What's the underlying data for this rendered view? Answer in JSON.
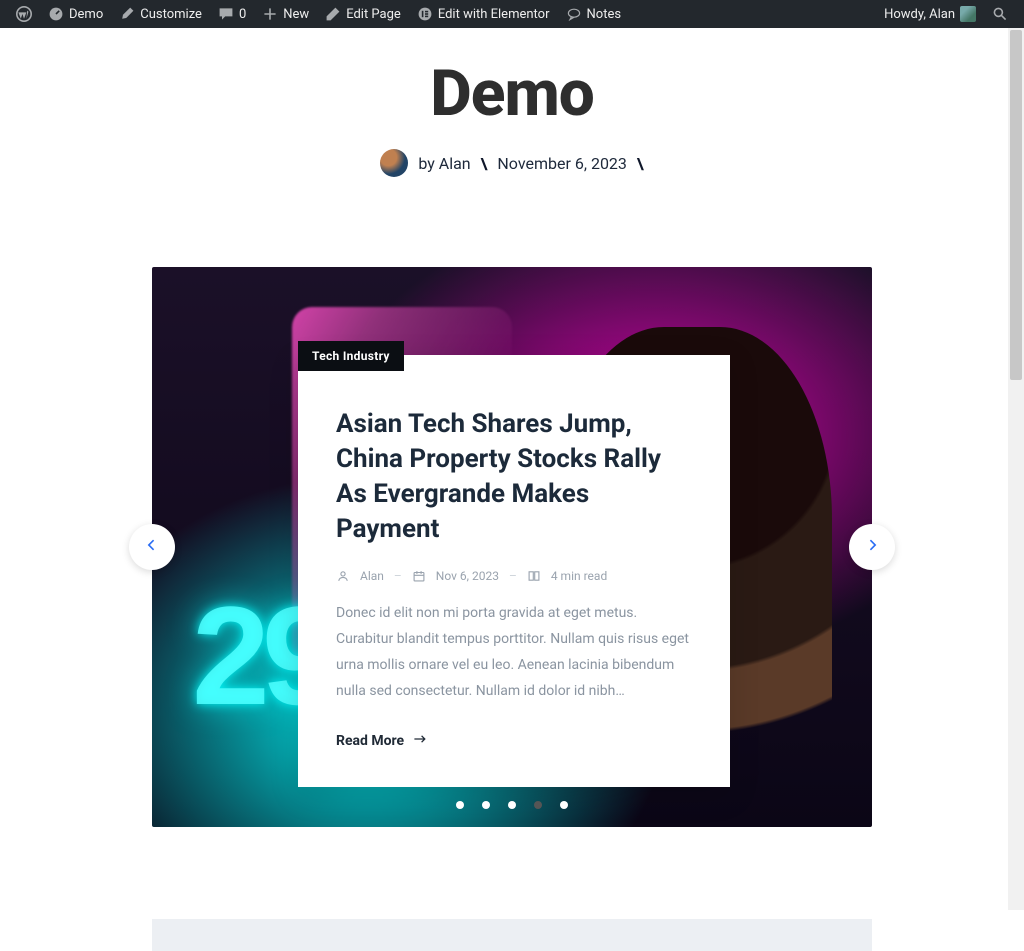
{
  "adminbar": {
    "site_name": "Demo",
    "customize": "Customize",
    "comments_count": "0",
    "new": "New",
    "edit_page": "Edit Page",
    "edit_elementor": "Edit with Elementor",
    "notes": "Notes",
    "howdy": "Howdy, Alan"
  },
  "header": {
    "title": "Demo",
    "byline_prefix": "by",
    "author": "Alan",
    "date": "November 6, 2023"
  },
  "slider": {
    "category": "Tech Industry",
    "title": "Asian Tech Shares Jump, China Property Stocks Rally As Evergrande Makes Payment",
    "meta": {
      "author": "Alan",
      "date": "Nov 6, 2023",
      "reading_time": "4 min read"
    },
    "excerpt": "Donec id elit non mi porta gravida at eget metus. Curabitur blandit tempus porttitor. Nullam quis risus eget urna mollis ornare vel eu leo. Aenean lacinia bibendum nulla sed consectetur. Nullam id dolor id nibh…",
    "read_more": "Read More",
    "neon_text": "29",
    "dot_count": 5,
    "active_dot_index": 3
  }
}
